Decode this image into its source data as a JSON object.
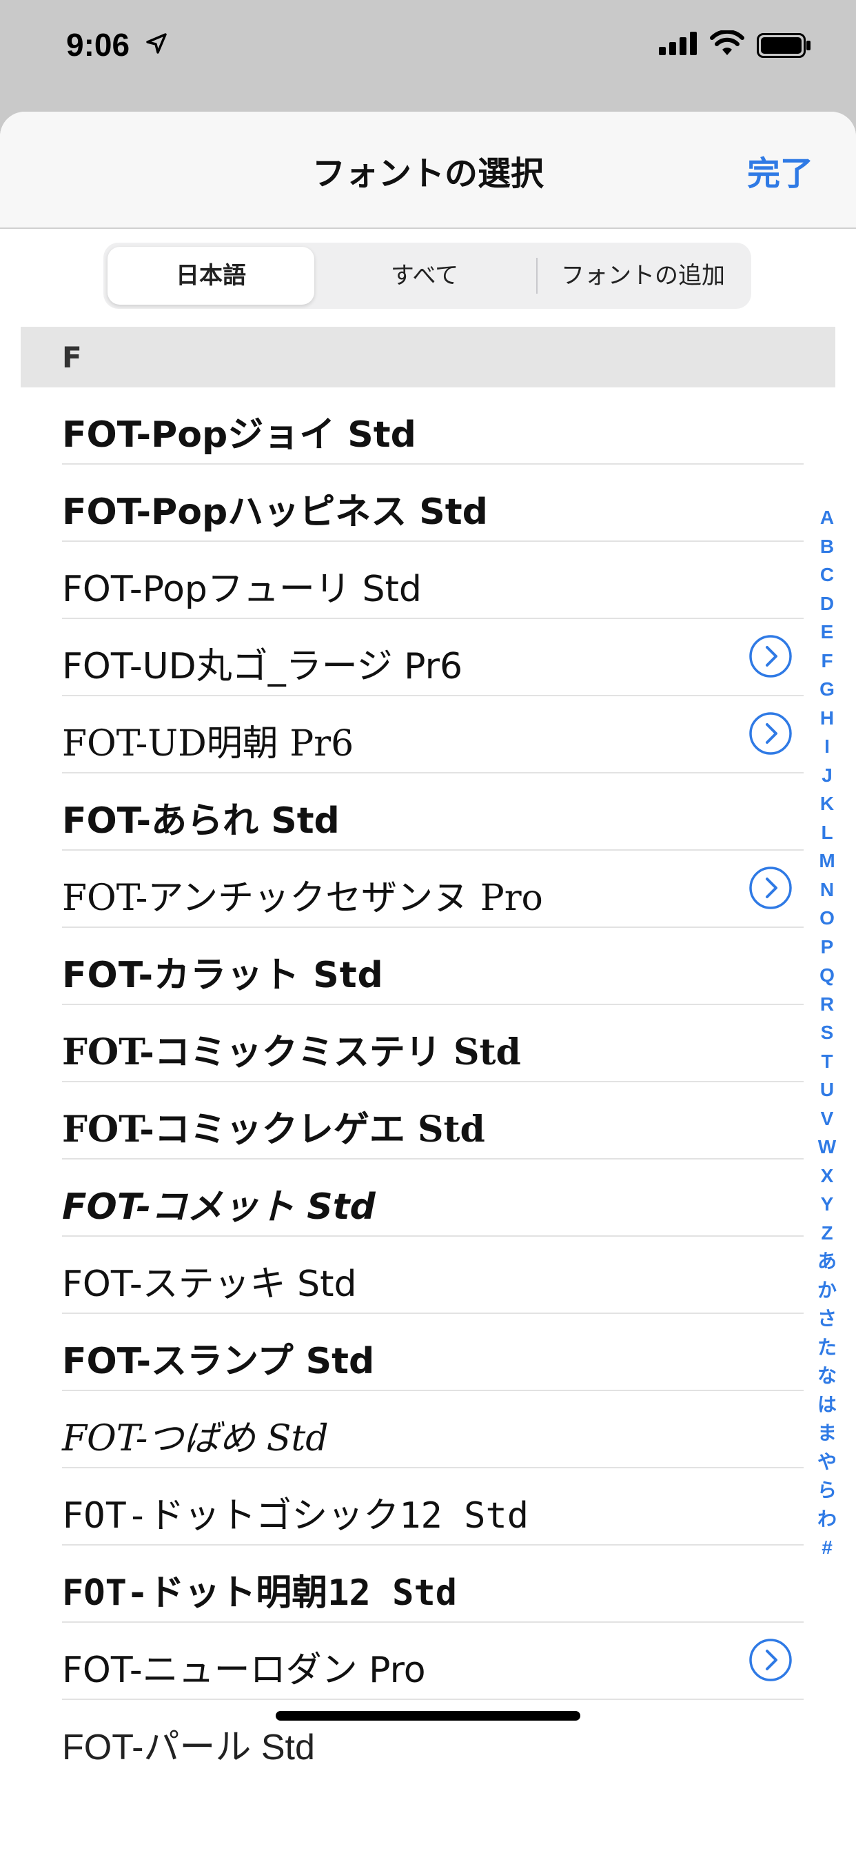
{
  "status": {
    "time": "9:06"
  },
  "nav": {
    "title": "フォントの選択",
    "done": "完了"
  },
  "segments": [
    "日本語",
    "すべて",
    "フォントの追加"
  ],
  "section": "F",
  "fonts": [
    {
      "label": "FOT-Popジョイ Std",
      "style": "bold",
      "detail": false
    },
    {
      "label": "FOT-Popハッピネス Std",
      "style": "bold",
      "detail": false
    },
    {
      "label": "FOT-Popフューリ Std",
      "style": "normal",
      "detail": false
    },
    {
      "label": "FOT-UD丸ゴ_ラージ Pr6",
      "style": "normal",
      "detail": true
    },
    {
      "label": "FOT-UD明朝 Pr6",
      "style": "serif",
      "detail": true
    },
    {
      "label": "FOT-あられ Std",
      "style": "bold",
      "detail": false
    },
    {
      "label": "FOT-アンチックセザンヌ Pro",
      "style": "serif",
      "detail": true
    },
    {
      "label": "FOT-カラット Std",
      "style": "heavy",
      "detail": false
    },
    {
      "label": "FOT-コミックミステリ Std",
      "style": "serif-bold",
      "detail": false
    },
    {
      "label": "FOT-コミックレゲエ Std",
      "style": "serif-bold",
      "detail": false
    },
    {
      "label": "FOT-コメット Std",
      "style": "italic-bold",
      "detail": false
    },
    {
      "label": "FOT-ステッキ Std",
      "style": "normal",
      "detail": false
    },
    {
      "label": "FOT-スランプ Std",
      "style": "bold",
      "detail": false
    },
    {
      "label": "FOT-つばめ Std",
      "style": "serif-italic",
      "detail": false
    },
    {
      "label": "FOT-ドットゴシック12 Std",
      "style": "mono",
      "detail": false
    },
    {
      "label": "FOT-ドット明朝12 Std",
      "style": "mono-bold",
      "detail": false
    },
    {
      "label": "FOT-ニューロダン Pro",
      "style": "normal",
      "detail": true
    },
    {
      "label": "FOT-パール Std",
      "style": "light",
      "detail": false
    }
  ],
  "index": [
    "A",
    "B",
    "C",
    "D",
    "E",
    "F",
    "G",
    "H",
    "I",
    "J",
    "K",
    "L",
    "M",
    "N",
    "O",
    "P",
    "Q",
    "R",
    "S",
    "T",
    "U",
    "V",
    "W",
    "X",
    "Y",
    "Z",
    "あ",
    "か",
    "さ",
    "た",
    "な",
    "は",
    "ま",
    "や",
    "ら",
    "わ",
    "#"
  ],
  "colors": {
    "accent": "#2f7ae5"
  }
}
